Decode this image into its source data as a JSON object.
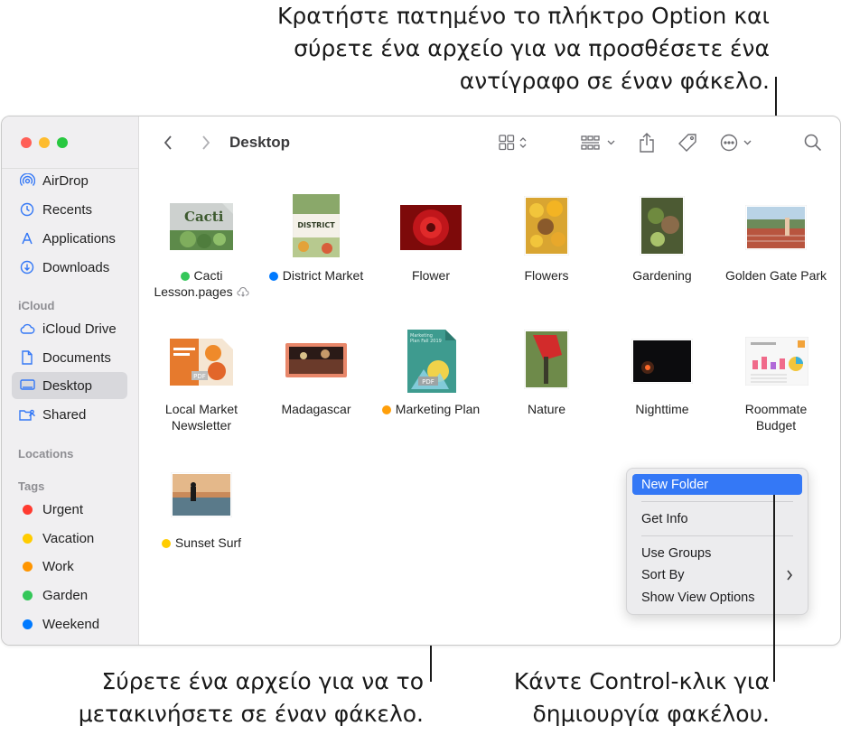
{
  "callouts": {
    "top_right": [
      "Κρατήστε πατημένο το πλήκτρο Option και",
      "σύρετε ένα αρχείο για να προσθέσετε ένα",
      "αντίγραφο σε έναν φάκελο."
    ],
    "bottom_left": [
      "Σύρετε ένα αρχείο για να το",
      "μετακινήσετε σε έναν φάκελο."
    ],
    "bottom_right": [
      "Κάντε Control-κλικ για",
      "δημιουργία φακέλου."
    ]
  },
  "window": {
    "title": "Desktop",
    "traffic_lights": {
      "close": "#ff5f57",
      "minimize": "#febc2e",
      "zoom": "#28c840"
    }
  },
  "sidebar": {
    "favorites": [
      {
        "label": "AirDrop",
        "icon": "airdrop-icon"
      },
      {
        "label": "Recents",
        "icon": "clock-icon"
      },
      {
        "label": "Applications",
        "icon": "applications-icon"
      },
      {
        "label": "Downloads",
        "icon": "download-icon"
      }
    ],
    "icloud_header": "iCloud",
    "icloud": [
      {
        "label": "iCloud Drive",
        "icon": "cloud-icon"
      },
      {
        "label": "Documents",
        "icon": "document-icon"
      },
      {
        "label": "Desktop",
        "icon": "desktop-icon",
        "selected": true
      },
      {
        "label": "Shared",
        "icon": "shared-folder-icon"
      }
    ],
    "locations_header": "Locations",
    "tags_header": "Tags",
    "tags": [
      {
        "label": "Urgent",
        "color": "#ff3b30"
      },
      {
        "label": "Vacation",
        "color": "#ffcc00"
      },
      {
        "label": "Work",
        "color": "#ff9500"
      },
      {
        "label": "Garden",
        "color": "#34c759"
      },
      {
        "label": "Weekend",
        "color": "#007aff"
      }
    ]
  },
  "files": [
    {
      "name": "Cacti Lesson.pages",
      "line1": "Cacti",
      "line2": "Lesson.pages",
      "tag_color": "#34c759",
      "icloud": true
    },
    {
      "name": "District Market",
      "tag_color": "#007aff"
    },
    {
      "name": "Flower"
    },
    {
      "name": "Flowers"
    },
    {
      "name": "Gardening"
    },
    {
      "name": "Golden Gate Park"
    },
    {
      "name": "Local Market Newsletter",
      "line1": "Local Market",
      "line2": "Newsletter"
    },
    {
      "name": "Madagascar"
    },
    {
      "name": "Marketing Plan",
      "tag_color": "#ff9f0a"
    },
    {
      "name": "Nature"
    },
    {
      "name": "Nighttime"
    },
    {
      "name": "Roommate Budget",
      "line1": "Roommate",
      "line2": "Budget"
    },
    {
      "name": "Sunset Surf",
      "tag_color": "#ffcc00"
    }
  ],
  "thumb_text": {
    "cacti": "Cacti",
    "district": "DISTRICT",
    "marketing_plan": "Marketing Plan Fall 2019",
    "pdf": "PDF"
  },
  "context_menu": {
    "new_folder": "New Folder",
    "get_info": "Get Info",
    "use_groups": "Use Groups",
    "sort_by": "Sort By",
    "show_view_options": "Show View Options"
  }
}
